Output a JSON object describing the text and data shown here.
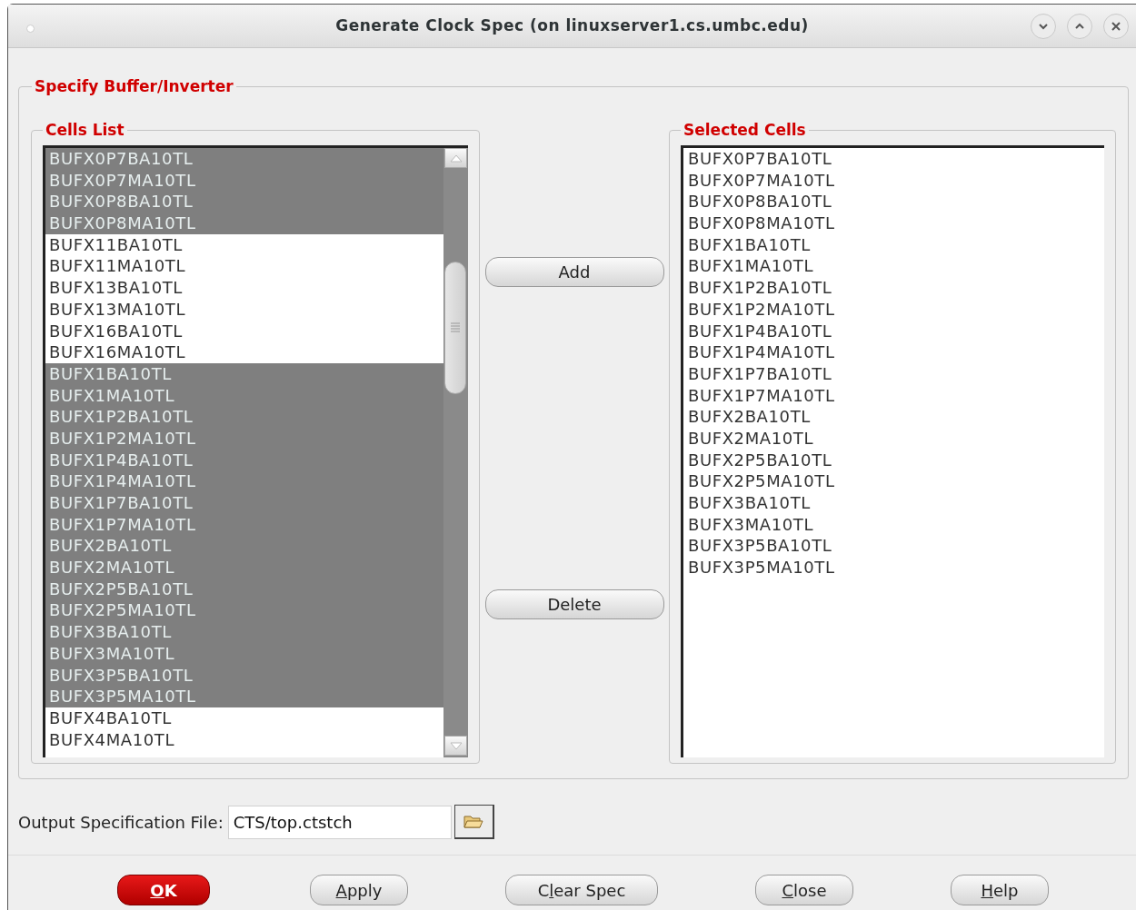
{
  "window": {
    "title": "Generate Clock Spec (on linuxserver1.cs.umbc.edu)"
  },
  "group": {
    "title": "Specify Buffer/Inverter"
  },
  "cells_list": {
    "title": "Cells List",
    "items": [
      {
        "label": "BUFX0P7BA10TL",
        "selected": true
      },
      {
        "label": "BUFX0P7MA10TL",
        "selected": true
      },
      {
        "label": "BUFX0P8BA10TL",
        "selected": true
      },
      {
        "label": "BUFX0P8MA10TL",
        "selected": true
      },
      {
        "label": "BUFX11BA10TL",
        "selected": false
      },
      {
        "label": "BUFX11MA10TL",
        "selected": false
      },
      {
        "label": "BUFX13BA10TL",
        "selected": false
      },
      {
        "label": "BUFX13MA10TL",
        "selected": false
      },
      {
        "label": "BUFX16BA10TL",
        "selected": false
      },
      {
        "label": "BUFX16MA10TL",
        "selected": false
      },
      {
        "label": "BUFX1BA10TL",
        "selected": true
      },
      {
        "label": "BUFX1MA10TL",
        "selected": true
      },
      {
        "label": "BUFX1P2BA10TL",
        "selected": true
      },
      {
        "label": "BUFX1P2MA10TL",
        "selected": true
      },
      {
        "label": "BUFX1P4BA10TL",
        "selected": true
      },
      {
        "label": "BUFX1P4MA10TL",
        "selected": true
      },
      {
        "label": "BUFX1P7BA10TL",
        "selected": true
      },
      {
        "label": "BUFX1P7MA10TL",
        "selected": true
      },
      {
        "label": "BUFX2BA10TL",
        "selected": true
      },
      {
        "label": "BUFX2MA10TL",
        "selected": true
      },
      {
        "label": "BUFX2P5BA10TL",
        "selected": true
      },
      {
        "label": "BUFX2P5MA10TL",
        "selected": true
      },
      {
        "label": "BUFX3BA10TL",
        "selected": true
      },
      {
        "label": "BUFX3MA10TL",
        "selected": true
      },
      {
        "label": "BUFX3P5BA10TL",
        "selected": true
      },
      {
        "label": "BUFX3P5MA10TL",
        "selected": true
      },
      {
        "label": "BUFX4BA10TL",
        "selected": false
      },
      {
        "label": "BUFX4MA10TL",
        "selected": false
      }
    ]
  },
  "add_button": "Add",
  "delete_button": "Delete",
  "selected_cells": {
    "title": "Selected Cells",
    "items": [
      "BUFX0P7BA10TL",
      "BUFX0P7MA10TL",
      "BUFX0P8BA10TL",
      "BUFX0P8MA10TL",
      "BUFX1BA10TL",
      "BUFX1MA10TL",
      "BUFX1P2BA10TL",
      "BUFX1P2MA10TL",
      "BUFX1P4BA10TL",
      "BUFX1P4MA10TL",
      "BUFX1P7BA10TL",
      "BUFX1P7MA10TL",
      "BUFX2BA10TL",
      "BUFX2MA10TL",
      "BUFX2P5BA10TL",
      "BUFX2P5MA10TL",
      "BUFX3BA10TL",
      "BUFX3MA10TL",
      "BUFX3P5BA10TL",
      "BUFX3P5MA10TL"
    ]
  },
  "output_file": {
    "label": "Output Specification File:",
    "value": "CTS/top.ctstch"
  },
  "buttons": [
    {
      "key": "O",
      "after": "K",
      "kind": "default"
    },
    {
      "key": "A",
      "after": "pply",
      "kind": "normal"
    },
    {
      "before": "C",
      "key": "l",
      "after": "ear Spec",
      "kind": "normal"
    },
    {
      "key": "C",
      "after": "lose",
      "kind": "normal"
    },
    {
      "key": "H",
      "after": "elp",
      "kind": "normal"
    }
  ]
}
